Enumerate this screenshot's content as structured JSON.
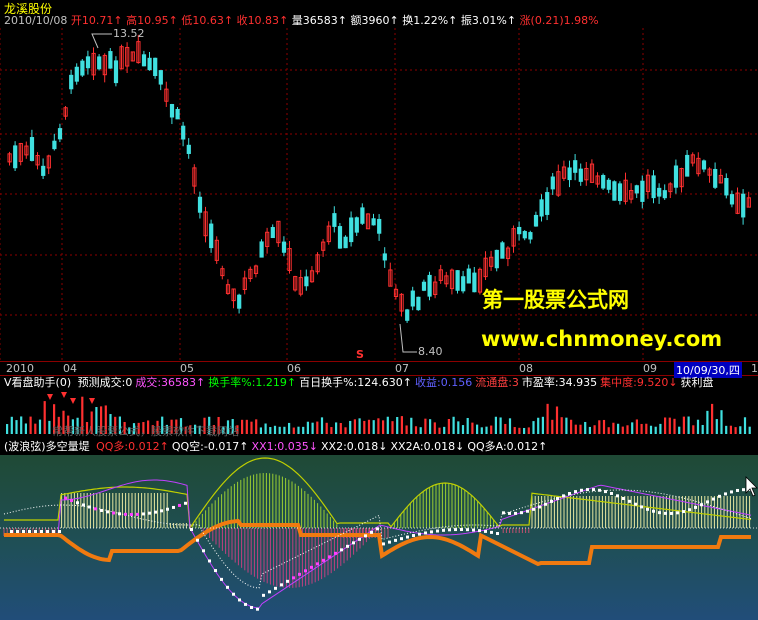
{
  "stock": {
    "name": "龙溪股份"
  },
  "ohlc_bar": {
    "date": "2010/10/08",
    "open_label": "开",
    "open_value": "10.71",
    "high_label": "高",
    "high_value": "10.95",
    "low_label": "低",
    "low_value": "10.63",
    "close_label": "收",
    "close_value": "10.83",
    "volume": "量36583",
    "amount": "额3960",
    "turnover": "换1.22%",
    "amplitude": "振3.01%",
    "change": "涨(0.21)1.98%"
  },
  "price_chart": {
    "high_marker": "13.52",
    "low_marker": "8.40",
    "s_marker": "S",
    "watermark_title": "第一股票公式网",
    "watermark_url": "www.chnmoney.com"
  },
  "time_axis": {
    "labels": [
      "2010",
      "04",
      "05",
      "06",
      "07",
      "08",
      "09"
    ],
    "cursor_date": "10/09/30,四",
    "tail_label": "1"
  },
  "volume_panel": {
    "title": "V看盘助手(0)",
    "items": [
      {
        "text": "预测成交:0",
        "color": "#ffffff"
      },
      {
        "text": "成交:36583↑",
        "color": "#ff55ff"
      },
      {
        "text": "换手率%:1.219↑",
        "color": "#00ff00"
      },
      {
        "text": "百日换手%:124.630↑",
        "color": "#ffffff"
      },
      {
        "text": "收益:0.156",
        "color": "#6060ff"
      },
      {
        "text": "流通盘:3",
        "color": "#ff4040"
      },
      {
        "text": "市盈率:34.935",
        "color": "#ffffff"
      },
      {
        "text": "集中度:9.520↓",
        "color": "#ff3030"
      },
      {
        "text": "获利盘",
        "color": "#ffffff"
      }
    ],
    "ghost_text": "常帮新人股票公式，股票软件下载网站"
  },
  "indicator_panel": {
    "title": "(波浪弦)多空量堤",
    "items": [
      {
        "text": "QQ多:0.012↑",
        "color": "#ff3030"
      },
      {
        "text": "QQ空:-0.017↑",
        "color": "#ffffff"
      },
      {
        "text": "XX1:0.035↓",
        "color": "#ff55ff"
      },
      {
        "text": "XX2:0.018↓",
        "color": "#ffffff"
      },
      {
        "text": "XX2A:0.018↓",
        "color": "#ffffff"
      },
      {
        "text": "QQ多A:0.012↑",
        "color": "#ffffff"
      }
    ]
  }
}
